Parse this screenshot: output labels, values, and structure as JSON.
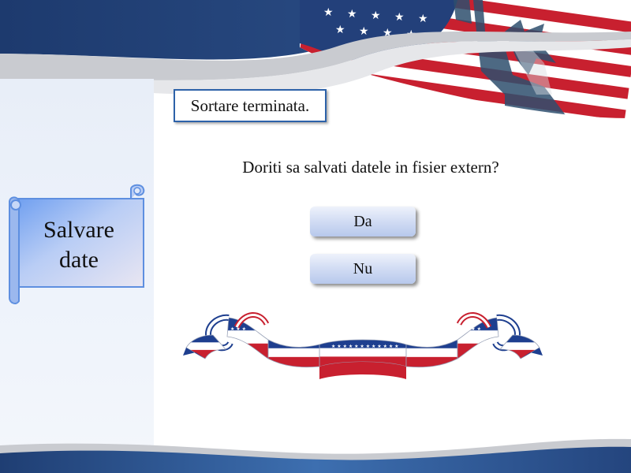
{
  "sidebar": {
    "title_line1": "Salvare",
    "title_line2": "date"
  },
  "status": {
    "text": "Sortare terminata."
  },
  "dialog": {
    "question": "Doriti sa salvati datele in fisier extern?",
    "yes_label": "Da",
    "no_label": "Nu"
  },
  "colors": {
    "navy": "#1f3e73",
    "accent_blue": "#2d62a9",
    "flag_red": "#c8202f"
  }
}
